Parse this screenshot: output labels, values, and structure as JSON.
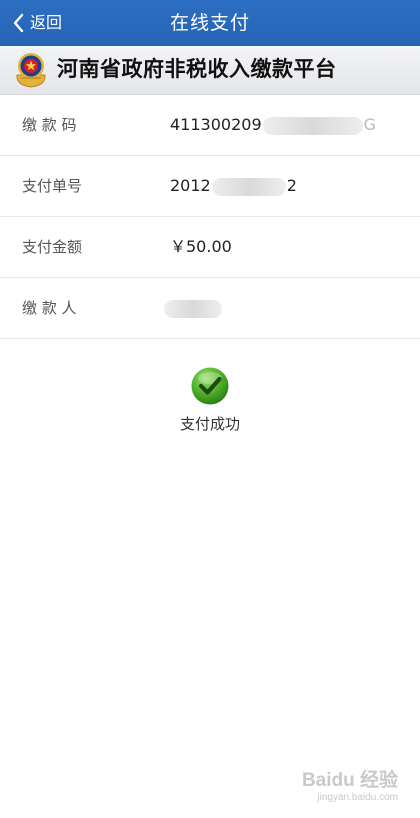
{
  "nav": {
    "back_label": "返回",
    "title": "在线支付"
  },
  "banner": {
    "title": "河南省政府非税收入缴款平台"
  },
  "fields": [
    {
      "label": "缴 款 码",
      "value_visible": "411300209",
      "value_tail": "G"
    },
    {
      "label": "支付单号",
      "value_start": "2012",
      "value_end": "2"
    },
    {
      "label": "支付金额",
      "value": "￥50.00"
    },
    {
      "label": "缴 款 人"
    }
  ],
  "status": {
    "label": "支付成功",
    "icon": "check-circle-icon"
  },
  "watermark": {
    "main": "Baidu 经验",
    "sub": "jingyan.baidu.com"
  },
  "colors": {
    "nav_bg": "#2563b5",
    "success_green": "#4caf2a"
  }
}
